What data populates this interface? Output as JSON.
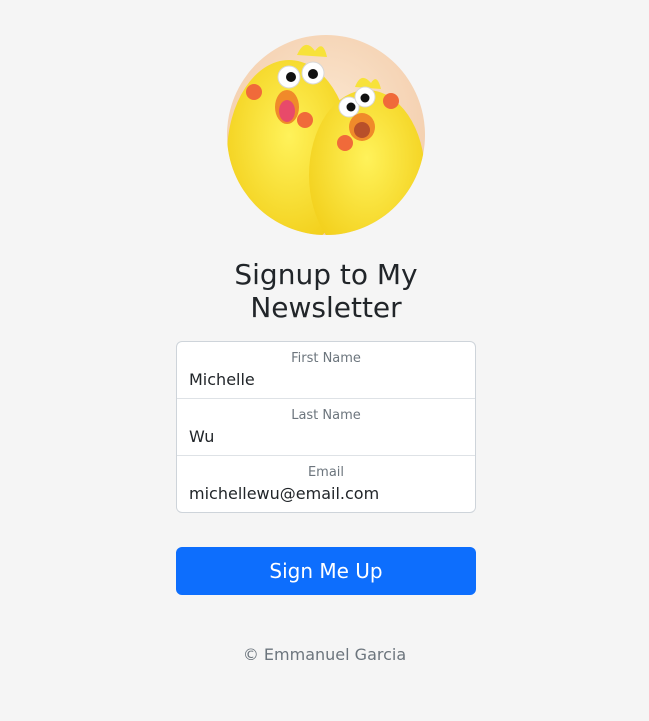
{
  "form": {
    "title": "Signup to My Newsletter",
    "fields": [
      {
        "label": "First Name",
        "value": "Michelle"
      },
      {
        "label": "Last Name",
        "value": "Wu"
      },
      {
        "label": "Email",
        "value": "michellewu@email.com"
      }
    ],
    "submit_label": "Sign Me Up"
  },
  "footer": {
    "text": "© Emmanuel Garcia"
  },
  "colors": {
    "background": "#f5f5f5",
    "primary_button": "#0d6efd",
    "muted_text": "#6c757d",
    "border": "#ced4da"
  },
  "avatar": {
    "icon": "yellow-chicks-avatar"
  }
}
